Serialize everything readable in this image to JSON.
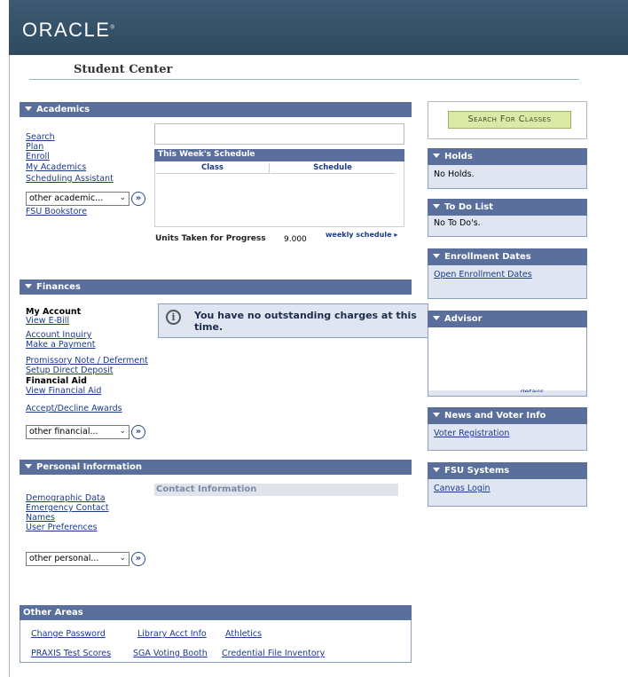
{
  "header": {
    "logo": "ORACLE",
    "logo_mark": "®"
  },
  "page_title": "Student Center",
  "academics": {
    "title": "Academics",
    "links": [
      "Search",
      "Plan",
      "Enroll",
      "My Academics",
      "Scheduling Assistant"
    ],
    "other_select": "other academic...",
    "bookstore": "FSU Bookstore",
    "schedule": {
      "title": "This Week's Schedule",
      "col_class": "Class",
      "col_schedule": "Schedule"
    },
    "units_label": "Units Taken for Progress",
    "units_value": "9.000",
    "weekly_link": "weekly schedule"
  },
  "finances": {
    "title": "Finances",
    "my_account_heading": "My Account",
    "links_a": [
      "View E-Bill"
    ],
    "links_b": [
      "Account Inquiry",
      "Make a Payment"
    ],
    "links_c": [
      "Promissory Note / Deferment",
      "Setup Direct Deposit"
    ],
    "financial_aid_heading": "Financial Aid",
    "links_d": [
      "View Financial Aid"
    ],
    "links_e": [
      "Accept/Decline Awards"
    ],
    "other_select": "other financial...",
    "info_message": "You have no outstanding charges at this time."
  },
  "personal": {
    "title": "Personal Information",
    "links": [
      "Demographic Data",
      "Emergency Contact",
      "Names",
      "User Preferences"
    ],
    "contact_heading": "Contact Information",
    "other_select": "other personal..."
  },
  "other_areas": {
    "title": "Other Areas",
    "row1": [
      "Change Password",
      "Library Acct Info",
      "Athletics"
    ],
    "row2": [
      "PRAXIS Test Scores",
      "SGA Voting Booth",
      "Credential File Inventory"
    ]
  },
  "right": {
    "search_button": "Search For Classes",
    "holds": {
      "title": "Holds",
      "text": "No Holds."
    },
    "todo": {
      "title": "To Do List",
      "text": "No To Do's."
    },
    "enrollment": {
      "title": "Enrollment Dates",
      "link": "Open Enrollment Dates"
    },
    "advisor": {
      "title": "Advisor",
      "details": "details"
    },
    "news": {
      "title": "News and Voter Info",
      "link": "Voter Registration"
    },
    "systems": {
      "title": "FSU Systems",
      "link": "Canvas Login"
    }
  }
}
